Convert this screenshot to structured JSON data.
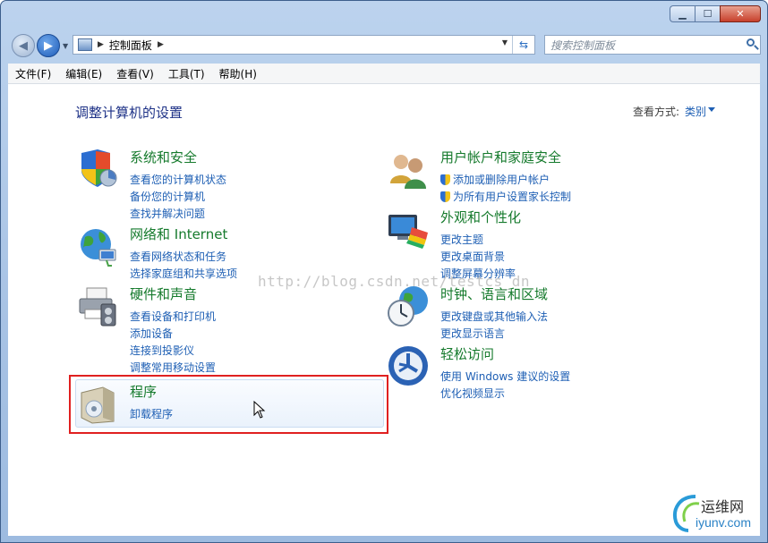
{
  "address": {
    "path": "控制面板"
  },
  "search": {
    "placeholder": "搜索控制面板"
  },
  "menu": [
    "文件(F)",
    "编辑(E)",
    "查看(V)",
    "工具(T)",
    "帮助(H)"
  ],
  "page_title": "调整计算机的设置",
  "view_by": {
    "label": "查看方式:",
    "value": "类别"
  },
  "categories": [
    {
      "title": "系统和安全",
      "links": [
        "查看您的计算机状态",
        "备份您的计算机",
        "查找并解决问题"
      ],
      "icon": "shield-icon"
    },
    {
      "title": "网络和 Internet",
      "links": [
        "查看网络状态和任务",
        "选择家庭组和共享选项"
      ],
      "icon": "network-globe-icon"
    },
    {
      "title": "硬件和声音",
      "links": [
        "查看设备和打印机",
        "添加设备",
        "连接到投影仪",
        "调整常用移动设置"
      ],
      "icon": "printer-icon"
    },
    {
      "title": "程序",
      "links": [
        "卸载程序"
      ],
      "icon": "programs-box-icon"
    },
    {
      "title": "用户帐户和家庭安全",
      "links": [
        "添加或删除用户帐户",
        "为所有用户设置家长控制"
      ],
      "icon": "users-icon"
    },
    {
      "title": "外观和个性化",
      "links": [
        "更改主题",
        "更改桌面背景",
        "调整屏幕分辨率"
      ],
      "icon": "monitor-palette-icon"
    },
    {
      "title": "时钟、语言和区域",
      "links": [
        "更改键盘或其他输入法",
        "更改显示语言"
      ],
      "icon": "clock-globe-icon"
    },
    {
      "title": "轻松访问",
      "links": [
        "使用 Windows 建议的设置",
        "优化视频显示"
      ],
      "icon": "ease-of-access-icon"
    }
  ],
  "watermark": "http://blog.csdn.net/testcs_dn",
  "logo": {
    "top": "运维网",
    "bottom": "iyunv.com"
  }
}
